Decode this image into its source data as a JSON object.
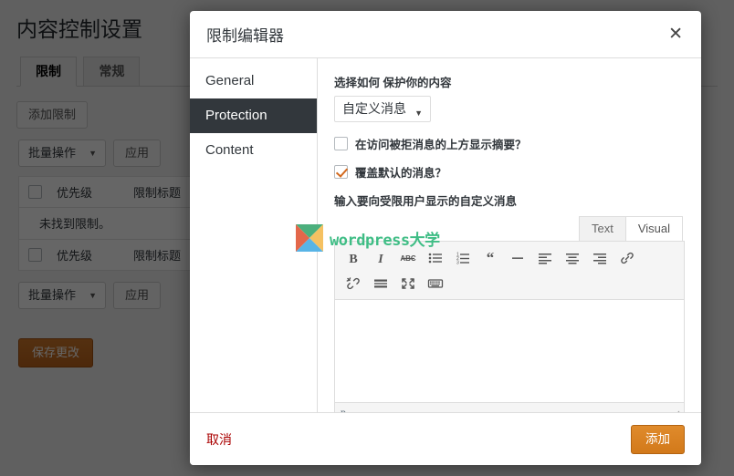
{
  "page": {
    "title": "内容控制设置",
    "tabs": [
      {
        "label": "限制",
        "active": true
      },
      {
        "label": "常规",
        "active": false
      }
    ],
    "add_restriction_label": "添加限制",
    "bulk_select_label": "批量操作",
    "apply_label": "应用",
    "table": {
      "columns": [
        "优先级",
        "限制标题"
      ],
      "empty_message": "未找到限制。"
    },
    "save_label": "保存更改"
  },
  "modal": {
    "title": "限制编辑器",
    "close_icon": "close-icon",
    "nav": [
      {
        "label": "General",
        "active": false
      },
      {
        "label": "Protection",
        "active": true
      },
      {
        "label": "Content",
        "active": false
      }
    ],
    "protection": {
      "how_label": "选择如何 保护你的内容",
      "how_value": "自定义消息",
      "show_excerpt_label": "在访问被拒消息的上方显示摘要？",
      "show_excerpt_checked": false,
      "override_label": "覆盖默认的消息？",
      "override_checked": true,
      "custom_message_label": "输入要向受限用户显示的自定义消息",
      "editor": {
        "tabs": [
          {
            "label": "Text",
            "active": false
          },
          {
            "label": "Visual",
            "active": true
          }
        ],
        "toolbar_row1": [
          "bold-icon",
          "italic-icon",
          "strikethrough-icon",
          "bulleted-list-icon",
          "numbered-list-icon",
          "blockquote-icon",
          "horizontal-rule-icon",
          "align-left-icon",
          "align-center-icon",
          "align-right-icon",
          "link-icon"
        ],
        "toolbar_row2": [
          "unlink-icon",
          "insert-read-more-icon",
          "fullscreen-icon",
          "toolbar-toggle-icon"
        ],
        "content": "",
        "status_path": "p"
      }
    },
    "footer": {
      "cancel_label": "取消",
      "add_label": "添加"
    }
  },
  "watermark": {
    "text": "wordpress大学"
  },
  "colors": {
    "accent_orange": "#d2791a",
    "nav_active_bg": "#32373c",
    "cancel_red": "#a00000",
    "watermark_green": "#3fbd85"
  }
}
